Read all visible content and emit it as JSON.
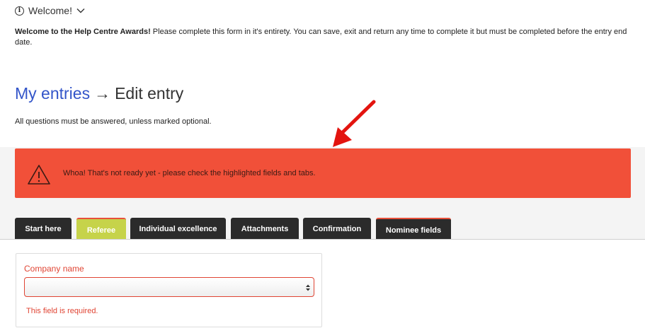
{
  "welcome": {
    "label": "Welcome!",
    "info_icon": "i"
  },
  "intro": {
    "bold": "Welcome to the Help Centre Awards!",
    "text": " Please complete this form in it's entirety. You can save, exit and return any time to complete it but must be completed before the entry end date."
  },
  "heading": {
    "link": "My entries",
    "separator": "→",
    "current": "Edit entry"
  },
  "note": "All questions must be answered, unless marked optional.",
  "alert": {
    "text": "Whoa! That's not ready yet - please check the highlighted fields and tabs.",
    "color": "#f15039"
  },
  "tabs": [
    {
      "label": "Start here",
      "state": "normal"
    },
    {
      "label": "Referee",
      "state": "active-error"
    },
    {
      "label": "Individual excellence",
      "state": "normal"
    },
    {
      "label": "Attachments",
      "state": "normal"
    },
    {
      "label": "Confirmation",
      "state": "normal"
    },
    {
      "label": "Nominee fields",
      "state": "error"
    }
  ],
  "form": {
    "field_label": "Company name",
    "selected_value": "",
    "error": "This field is required."
  },
  "colors": {
    "link": "#3355c9",
    "error": "#e04534",
    "active_tab": "#c6d34a",
    "tab_bg": "#2b2b2b"
  }
}
